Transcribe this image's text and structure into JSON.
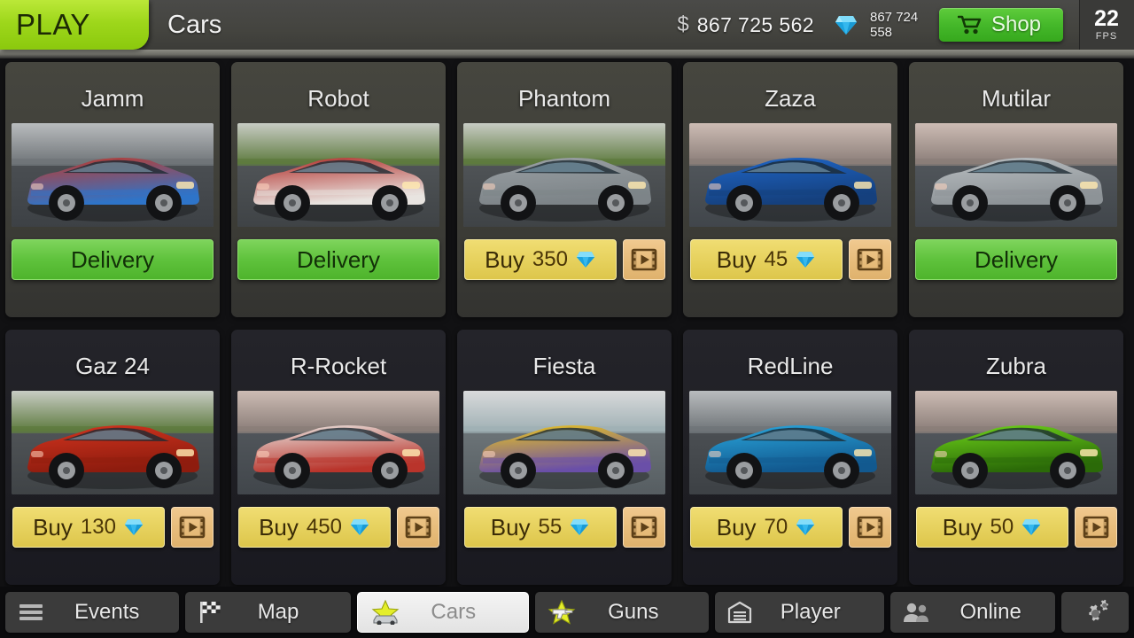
{
  "header": {
    "play_label": "PLAY",
    "page_title": "Cars",
    "cash_symbol": "$",
    "cash_amount": "867 725 562",
    "gem_amount": "867 724 558",
    "shop_label": "Shop",
    "fps_value": "22",
    "fps_label": "FPS",
    "cash_icon": "dollar-icon",
    "gem_icon": "gem-icon",
    "shop_icon": "shopping-cart-icon"
  },
  "colors": {
    "play_green": "#9ed71b",
    "shop_green": "#45b82a",
    "delivery_green": "#5fc23c",
    "buy_yellow": "#e7d25f",
    "video_orange": "#e8bd7c",
    "gem_blue": "#31c3f2",
    "topbar_gray": "#44443f",
    "card_light": "#3e3e38",
    "card_dark": "#1e1e23",
    "nav_bg": "#0b0b0d",
    "nav_btn": "#3b3b3b"
  },
  "rows": [
    {
      "tone": "light",
      "cards": [
        {
          "name": "Jamm",
          "action": "delivery",
          "action_label": "Delivery",
          "car_color": "#c0392b",
          "car_color2": "#2e74c9",
          "bg_kind": "track-gray"
        },
        {
          "name": "Robot",
          "action": "delivery",
          "action_label": "Delivery",
          "car_color": "#b02a26",
          "car_color2": "#e8e4e0",
          "bg_kind": "track-green"
        },
        {
          "name": "Phantom",
          "action": "buy",
          "buy_label": "Buy",
          "price": "350",
          "car_color": "#9aa0a4",
          "car_color2": "#7d8488",
          "bg_kind": "track-green"
        },
        {
          "name": "Zaza",
          "action": "buy",
          "buy_label": "Buy",
          "price": "45",
          "car_color": "#1f66c8",
          "car_color2": "#15407d",
          "bg_kind": "track-dusk"
        },
        {
          "name": "Mutilar",
          "action": "delivery",
          "action_label": "Delivery",
          "car_color": "#b9bec1",
          "car_color2": "#8d9397",
          "bg_kind": "track-dusk"
        }
      ]
    },
    {
      "tone": "dark",
      "cards": [
        {
          "name": "Gaz 24",
          "action": "buy",
          "buy_label": "Buy",
          "price": "130",
          "car_color": "#d3341f",
          "car_color2": "#8e1c0e",
          "bg_kind": "track-green"
        },
        {
          "name": "R-Rocket",
          "action": "buy",
          "buy_label": "Buy",
          "price": "450",
          "car_color": "#e9e6e2",
          "car_color2": "#b9342b",
          "bg_kind": "track-dusk"
        },
        {
          "name": "Fiesta",
          "action": "buy",
          "buy_label": "Buy",
          "price": "55",
          "car_color": "#ecc71d",
          "car_color2": "#6a4fa8",
          "bg_kind": "track-pale"
        },
        {
          "name": "RedLine",
          "action": "buy",
          "buy_label": "Buy",
          "price": "70",
          "car_color": "#2aa7dd",
          "car_color2": "#12598f",
          "bg_kind": "track-gray"
        },
        {
          "name": "Zubra",
          "action": "buy",
          "buy_label": "Buy",
          "price": "50",
          "car_color": "#6fd41a",
          "car_color2": "#2b6a08",
          "bg_kind": "track-dusk"
        }
      ]
    }
  ],
  "nav": {
    "items": [
      {
        "label": "Events",
        "icon": "hamburger-menu-icon",
        "active": false
      },
      {
        "label": "Map",
        "icon": "checkered-flag-icon",
        "active": false
      },
      {
        "label": "Cars",
        "icon": "star-car-icon",
        "active": true
      },
      {
        "label": "Guns",
        "icon": "star-gun-icon",
        "active": false
      },
      {
        "label": "Player",
        "icon": "garage-icon",
        "active": false
      },
      {
        "label": "Online",
        "icon": "people-icon",
        "active": false
      }
    ],
    "settings_icon": "gears-icon"
  }
}
